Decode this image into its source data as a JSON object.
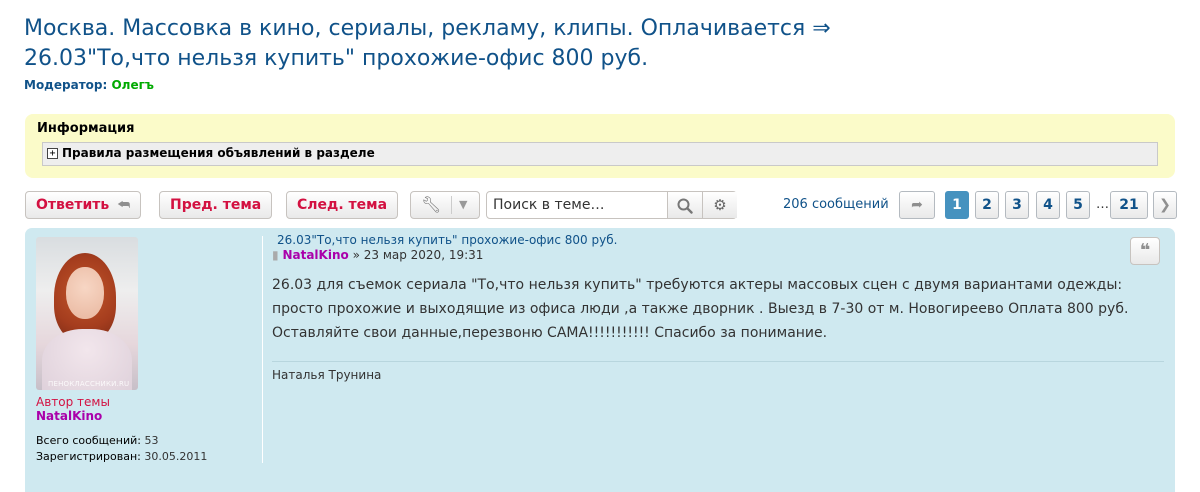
{
  "topic": {
    "title": "Москва. Массовка в кино, сериалы, рекламу, клипы. Оплачивается ⇒ 26.03\"То,что нельзя купить\" прохожие-офис 800 руб.",
    "moderator_label": "Модератор:",
    "moderator_name": "Олегъ"
  },
  "info": {
    "title": "Информация",
    "toggle": "+",
    "rules_link": "Правила размещения объявлений в разделе"
  },
  "toolbar": {
    "reply": "Ответить",
    "prev_topic": "Пред. тема",
    "next_topic": "След. тема",
    "search_placeholder": "Поиск в теме…",
    "post_count": "206 сообщений",
    "pages": [
      "1",
      "2",
      "3",
      "4",
      "5"
    ],
    "current_page": "1",
    "ellipsis": "…",
    "last_page": "21",
    "icons": {
      "reply": "reply-arrow-icon",
      "tools": "wrench-icon",
      "dropdown": "chevron-down-icon",
      "search": "search-icon",
      "advanced_search": "gear-icon",
      "jump": "jump-arrow-icon",
      "next": "chevron-right-icon"
    }
  },
  "post": {
    "subject": "26.03\"То,что нельзя купить\" прохожие-офис 800 руб.",
    "author": "NatalKino",
    "date_separator": "»",
    "date": "23 мар 2020, 19:31",
    "body": "26.03 для съемок сериала \"То,что нельзя купить\" требуются актеры массовых сцен с двумя вариантами одежды: просто прохожие и выходящие из офиса люди ,а также дворник . Выезд в 7-30 от м. Новогиреево Оплата 800 руб. Оставляйте свои данные,перезвоню САМА!!!!!!!!!!! Спасибо за понимание.",
    "signature": "Наталья Трунина",
    "quote_icon": "quote-icon"
  },
  "profile": {
    "role": "Автор темы",
    "name": "NatalKino",
    "posts_label": "Всего сообщений:",
    "posts_value": "53",
    "registered_label": "Зарегистрирован:",
    "registered_value": "30.05.2011",
    "avatar_watermark": "ПЕНОКЛАССНИКИ.RU"
  },
  "colors": {
    "title": "#105289",
    "button_text": "#d31141",
    "post_bg": "#cfe9f0",
    "info_bg": "#fbfbc9",
    "active_page": "#4692bf",
    "author": "#aa00aa",
    "moderator": "#00aa00"
  }
}
